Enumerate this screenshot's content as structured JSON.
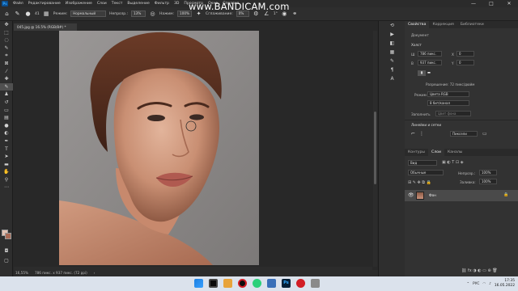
{
  "app": {
    "logo_text": "Ps",
    "menu": [
      "Файл",
      "Редактирование",
      "Изображение",
      "Слои",
      "Текст",
      "Выделение",
      "Фильтр",
      "3D",
      "Просмотр",
      "Окно",
      "Справка"
    ],
    "window_controls": [
      "—",
      "□",
      "✕"
    ]
  },
  "watermark": "www.BANDICAM.com",
  "options_bar": {
    "size_value": "41",
    "mode_label": "Режим:",
    "mode_value": "Нормальный",
    "opacity_label": "Непрозр.:",
    "opacity_value": "13%",
    "flow_label": "Нажим:",
    "flow_value": "100%",
    "smoothing_label": "Сглаживание:",
    "smoothing_value": "0%",
    "angle_value": "1°"
  },
  "document": {
    "tab_label": "045.jpg @ 16.5% (RGB/8#) *",
    "zoom": "16,55%",
    "dimensions_status": "786 пикс. x 937 пикс. (72 ppi)"
  },
  "panel": {
    "tabs": [
      "Свойства",
      "Коррекция",
      "Библиотеки"
    ],
    "section_document": "Документ",
    "section_canvas": "Холст",
    "width_label": "Ш",
    "width_value": "786 пикс.",
    "x_label": "X",
    "x_value": "0",
    "height_label": "В",
    "height_value": "937 пикс.",
    "y_label": "Y",
    "y_value": "0",
    "resolution_text": "Разрешение: 72 пикс/дюйм",
    "mode_label": "Режим",
    "mode_value": "Цвета RGB",
    "depth_value": "8 бит/канал",
    "fill_label": "Заполнить",
    "fill_value": "Цвет фона",
    "section_guides": "Линейки и сетки",
    "guides_unit": "Пиксели"
  },
  "layers": {
    "tabs": [
      "Контуры",
      "Слои",
      "Каналы"
    ],
    "kind_value": "Вид",
    "blend_value": "Обычные",
    "opacity_label": "Непрозр.:",
    "opacity_value": "100%",
    "fill_label": "Заливка:",
    "fill_value": "100%",
    "items": [
      {
        "name": "Фон"
      }
    ]
  },
  "taskbar": {
    "time": "17:35",
    "date": "16.05.2022",
    "lang": "РУС"
  },
  "colors": {
    "foreground_swatch": "#e3c2b3",
    "background_swatch": "#a96a55",
    "accent": "#31a8ff"
  }
}
